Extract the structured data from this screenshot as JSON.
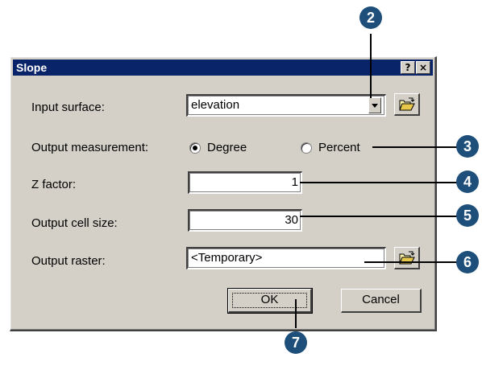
{
  "dialog": {
    "title": "Slope",
    "help_button": "?",
    "close_button": "×"
  },
  "form": {
    "input_surface_label": "Input surface:",
    "input_surface_value": "elevation",
    "output_measurement_label": "Output measurement:",
    "degree_label": "Degree",
    "percent_label": "Percent",
    "selected_measurement": "Degree",
    "z_factor_label": "Z factor:",
    "z_factor_value": "1",
    "cell_size_label": "Output cell size:",
    "cell_size_value": "30",
    "output_raster_label": "Output raster:",
    "output_raster_value": "<Temporary>"
  },
  "buttons": {
    "ok": "OK",
    "cancel": "Cancel"
  },
  "callouts": [
    "2",
    "3",
    "4",
    "5",
    "6",
    "7"
  ],
  "colors": {
    "titlebar": "#0a246a",
    "dialog_face": "#d4d0c8",
    "callout": "#1d4f7a"
  }
}
